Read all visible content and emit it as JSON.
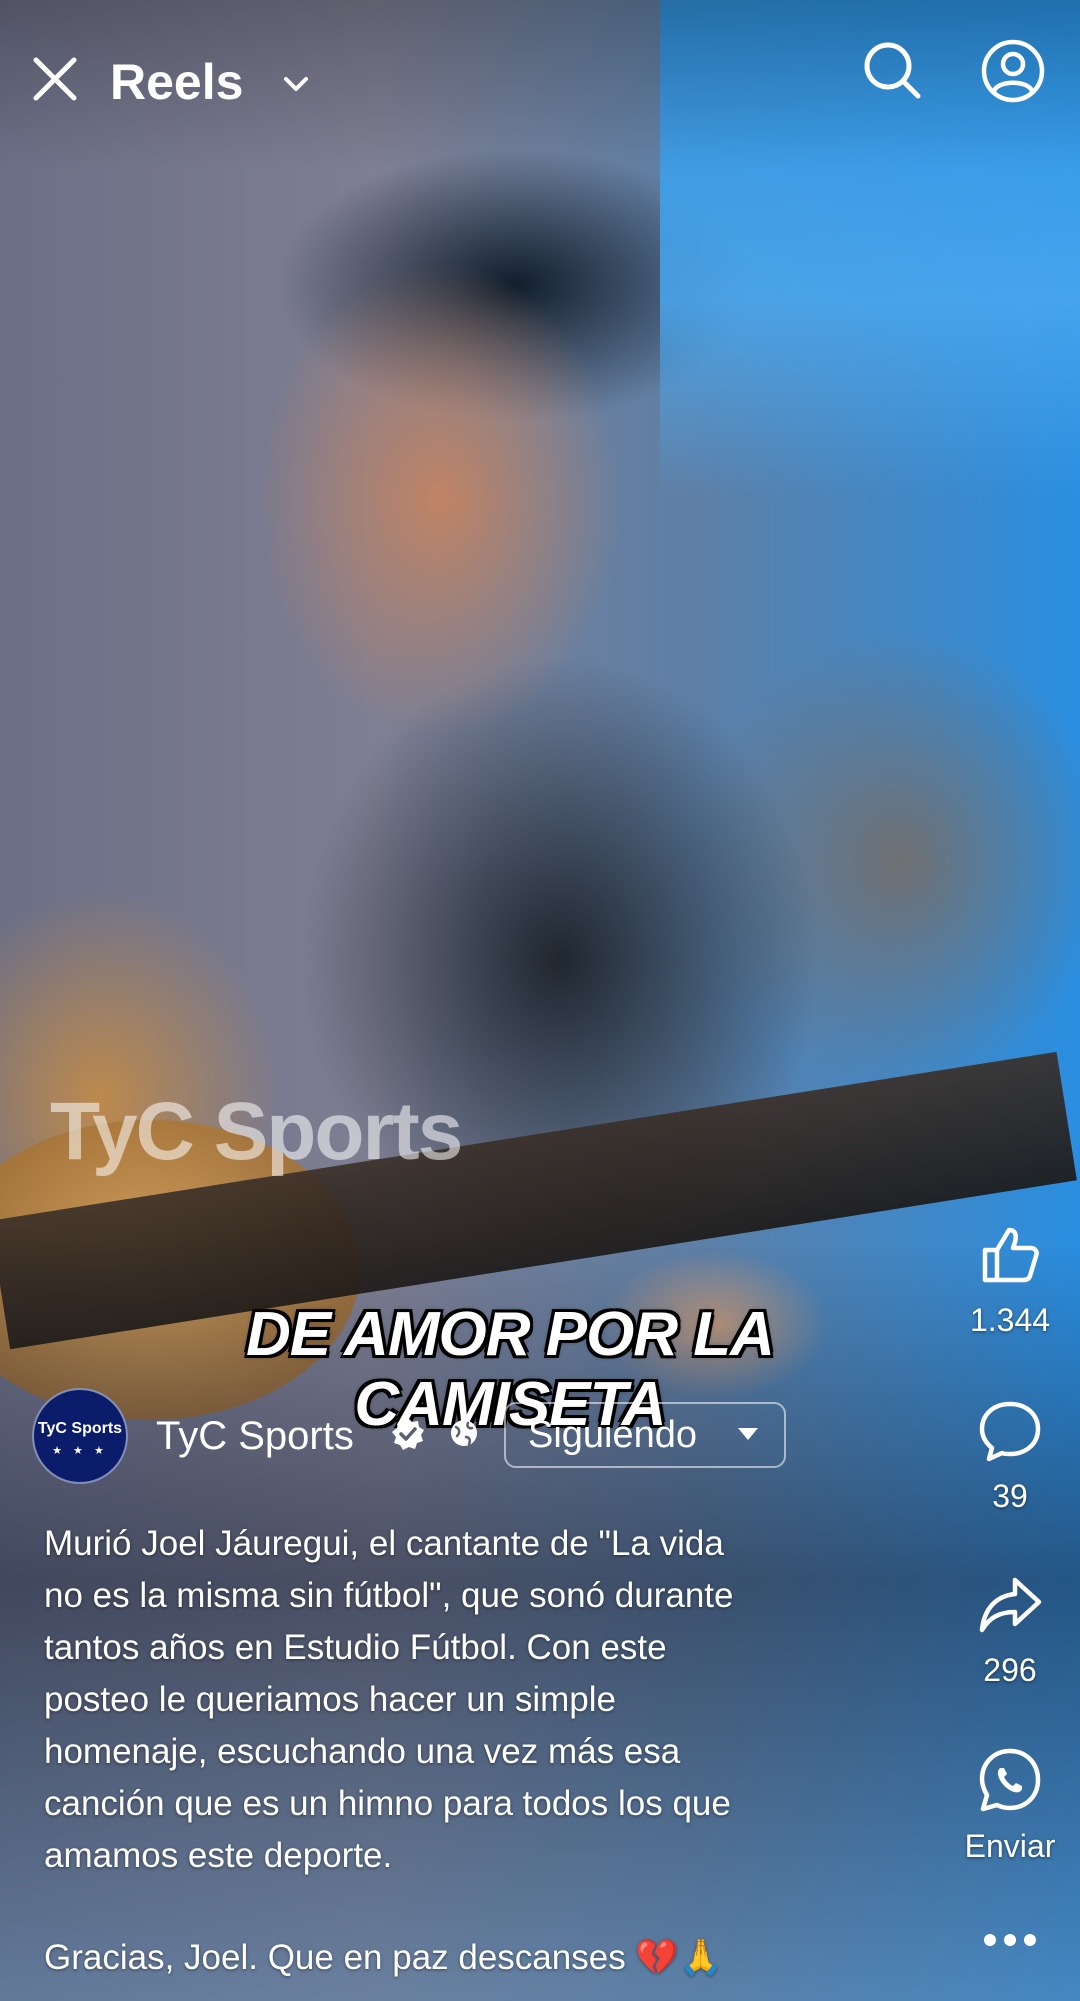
{
  "top_bar": {
    "title": "Reels"
  },
  "video": {
    "watermark": "TyC Sports",
    "caption": "DE AMOR POR LA CAMISETA"
  },
  "actions": {
    "like_count": "1.344",
    "comment_count": "39",
    "share_count": "296",
    "whatsapp_label": "Enviar"
  },
  "author": {
    "avatar_text": "TyC Sports",
    "avatar_stars": "★ ★ ★",
    "name": "TyC Sports",
    "follow_label": "Siguiendo"
  },
  "description": {
    "text": "Murió Joel Jáuregui, el cantante de \"La vida\nno es la misma sin fútbol\", que sonó durante\ntantos años en Estudio Fútbol. Con este\nposteo le queriamos hacer un simple\nhomenaje, escuchando una vez más esa\ncanción que es un himno para todos los que\namamos este deporte.",
    "closing": "Gracias, Joel. Que en paz descanses 💔🙏"
  },
  "colors": {
    "avatar_bg": "#0b1c6b",
    "text": "#ffffff"
  },
  "icons": [
    "close-icon",
    "chevron-down-icon",
    "search-icon",
    "profile-icon",
    "like-icon",
    "comment-icon",
    "share-icon",
    "whatsapp-icon",
    "more-icon",
    "verified-icon",
    "globe-icon"
  ]
}
